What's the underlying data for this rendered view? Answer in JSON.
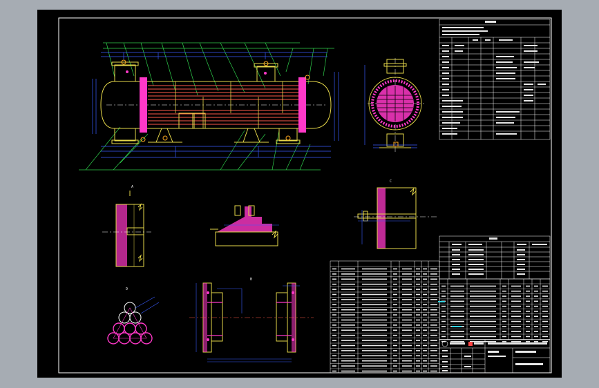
{
  "drawing": {
    "view_labels": {
      "section_a": "A",
      "section_b": "B",
      "section_c": "C",
      "section_d": "D"
    },
    "title_block": {
      "school": "",
      "designation": "",
      "scale": ""
    },
    "sheet_mark": ""
  },
  "colors": {
    "background_window": "#a6acb3",
    "sheet": "#000000",
    "frame": "#ffffff",
    "yellow_lines": "#e6d84a",
    "blue_dims": "#3a5cff",
    "green_leaders": "#2fd14c",
    "magenta_hatch": "#ff38c8",
    "red_tubes": "#ff5a4a",
    "cyan": "#35d6e6"
  }
}
